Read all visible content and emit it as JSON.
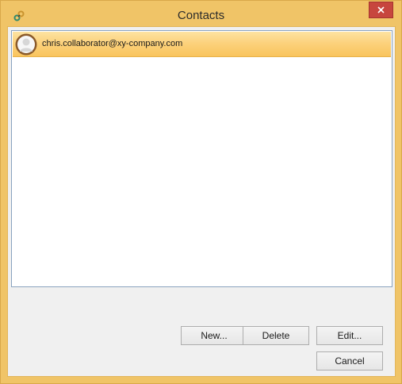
{
  "window": {
    "title": "Contacts",
    "app_icon": "link-icon",
    "close_icon": "close-icon"
  },
  "contacts": {
    "items": [
      {
        "email": "chris.collaborator@xy-company.com",
        "avatar": "person-avatar-icon",
        "selected": true
      }
    ]
  },
  "buttons": {
    "new_label": "New...",
    "delete_label": "Delete",
    "edit_label": "Edit...",
    "cancel_label": "Cancel"
  },
  "colors": {
    "frame": "#f0c467",
    "close_button": "#c7463e",
    "selection": "#fcd27d"
  }
}
